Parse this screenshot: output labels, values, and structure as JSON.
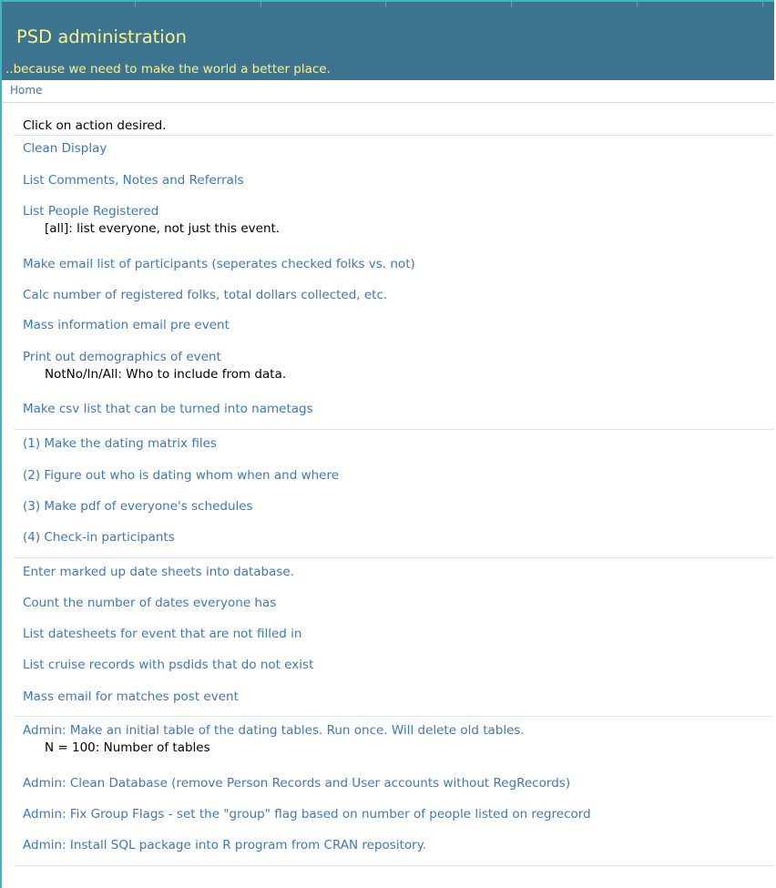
{
  "header": {
    "title": "PSD administration",
    "subtitle": "..because we need to make the world a better place."
  },
  "breadcrumb": {
    "home": "Home"
  },
  "main": {
    "prompt": "Click on action desired.",
    "actions": [
      {
        "label": "Clean Display"
      },
      {
        "label": "List Comments, Notes and Referrals"
      },
      {
        "label": "List People Registered",
        "note": "[all]: list everyone, not just this event."
      },
      {
        "label": "Make email list of participants (seperates checked folks vs. not)"
      },
      {
        "label": "Calc number of registered folks, total dollars collected, etc."
      },
      {
        "label": "Mass information email pre event"
      },
      {
        "label": "Print out demographics of event",
        "note": "NotNo/In/All: Who to include from data."
      },
      {
        "label": "Make csv list that can be turned into nametags"
      },
      {
        "label": "(1) Make the dating matrix files"
      },
      {
        "label": "(2) Figure out who is dating whom when and where"
      },
      {
        "label": "(3) Make pdf of everyone's schedules"
      },
      {
        "label": "(4) Check-in participants"
      },
      {
        "label": "Enter marked up date sheets into database."
      },
      {
        "label": "Count the number of dates everyone has"
      },
      {
        "label": "List datesheets for event that are not filled in"
      },
      {
        "label": "List cruise records with psdids that do not exist"
      },
      {
        "label": "Mass email for matches post event"
      },
      {
        "label": "Admin: Make an initial table of the dating tables. Run once. Will delete old tables.",
        "note": "N = 100: Number of tables"
      },
      {
        "label": "Admin: Clean Database (remove Person Records and User accounts without RegRecords)"
      },
      {
        "label": "Admin: Fix Group Flags - set the \"group\" flag based on number of people listed on regrecord"
      },
      {
        "label": "Admin: Install SQL package into R program from CRAN repository."
      }
    ]
  },
  "colors": {
    "header_bg": "#3d7590",
    "header_text": "#fbf28c",
    "link": "#3f78b8",
    "frame_accent": "#3fb6bf"
  }
}
